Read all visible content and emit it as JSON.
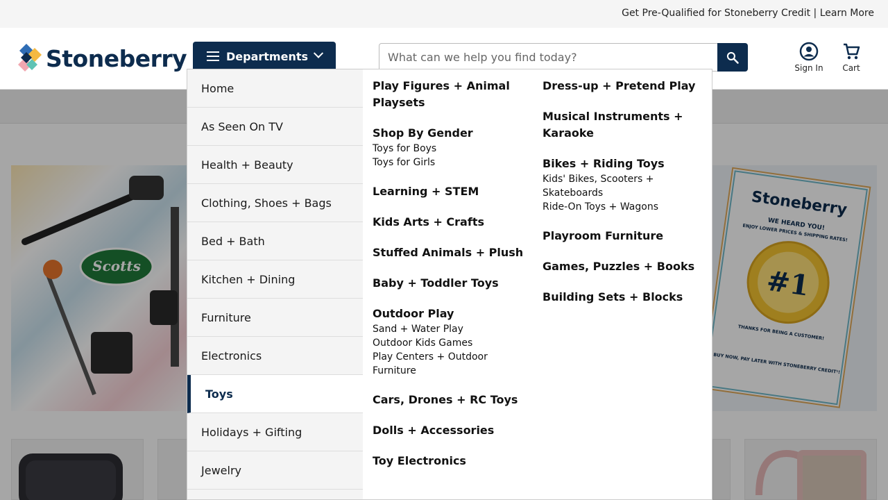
{
  "topbar": {
    "prequal_text": "Get Pre-Qualified for Stoneberry Credit",
    "separator": "|",
    "learn_more": "Learn More"
  },
  "header": {
    "logo_text": "Stoneberry",
    "departments_label": "Departments",
    "search_placeholder": "What can we help you find today?",
    "sign_in": "Sign In",
    "cart": "Cart"
  },
  "brand_colors": {
    "navy": "#0d2c4e",
    "logo_blue": "#2f6db5",
    "logo_yellow": "#f4b942",
    "logo_teal": "#5fc3b5",
    "logo_pink": "#f2a7b0"
  },
  "menu": {
    "departments": [
      {
        "label": "Home",
        "active": false
      },
      {
        "label": "As Seen On TV",
        "active": false
      },
      {
        "label": "Health + Beauty",
        "active": false
      },
      {
        "label": "Clothing, Shoes + Bags",
        "active": false
      },
      {
        "label": "Bed + Bath",
        "active": false
      },
      {
        "label": "Kitchen + Dining",
        "active": false
      },
      {
        "label": "Furniture",
        "active": false
      },
      {
        "label": "Electronics",
        "active": false
      },
      {
        "label": "Toys",
        "active": true
      },
      {
        "label": "Holidays + Gifting",
        "active": false
      },
      {
        "label": "Jewelry",
        "active": false
      }
    ],
    "col1": [
      {
        "title": "Play Figures + Animal Playsets",
        "subs": []
      },
      {
        "title": "Shop By Gender",
        "subs": [
          "Toys for Boys",
          "Toys for Girls"
        ]
      },
      {
        "title": "Learning + STEM",
        "subs": []
      },
      {
        "title": "Kids Arts + Crafts",
        "subs": []
      },
      {
        "title": "Stuffed Animals + Plush",
        "subs": []
      },
      {
        "title": "Baby + Toddler Toys",
        "subs": []
      },
      {
        "title": "Outdoor Play",
        "subs": [
          "Sand + Water Play",
          "Outdoor Kids Games",
          "Play Centers + Outdoor Furniture"
        ]
      },
      {
        "title": "Cars, Drones + RC Toys",
        "subs": []
      },
      {
        "title": "Dolls + Accessories",
        "subs": []
      },
      {
        "title": "Toy Electronics",
        "subs": []
      }
    ],
    "col2": [
      {
        "title": "Dress-up + Pretend Play",
        "subs": []
      },
      {
        "title": "Musical Instruments + Karaoke",
        "subs": []
      },
      {
        "title": "Bikes + Riding Toys",
        "subs": [
          "Kids' Bikes, Scooters + Skateboards",
          "Ride-On Toys + Wagons"
        ]
      },
      {
        "title": "Playroom Furniture",
        "subs": []
      },
      {
        "title": "Games, Puzzles + Books",
        "subs": []
      },
      {
        "title": "Building Sets + Blocks",
        "subs": []
      }
    ]
  },
  "background": {
    "hero_left_brand": "Scotts",
    "hero_right_brand": "Stoneberry",
    "hero_right_badge": "#1",
    "hero_right_headline": "WE HEARD YOU!",
    "hero_right_subline": "ENJOY LOWER PRICES & SHIPPING RATES!",
    "hero_right_seal": "THANKS FOR BEING A CUSTOMER!",
    "hero_right_footer": "BUY NOW, PAY LATER WITH STONEBERRY CREDIT¹!"
  }
}
